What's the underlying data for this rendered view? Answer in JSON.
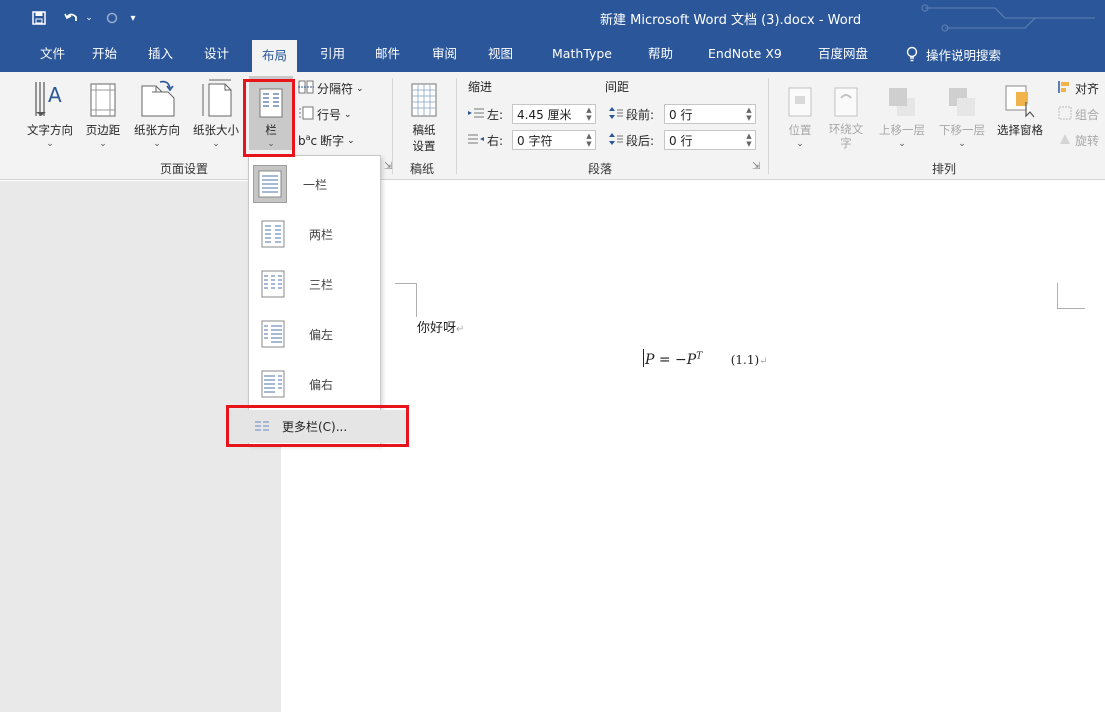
{
  "window": {
    "title": "新建 Microsoft Word 文档 (3).docx - Word"
  },
  "tabs": [
    {
      "label": "文件"
    },
    {
      "label": "开始"
    },
    {
      "label": "插入"
    },
    {
      "label": "设计"
    },
    {
      "label": "布局"
    },
    {
      "label": "引用"
    },
    {
      "label": "邮件"
    },
    {
      "label": "审阅"
    },
    {
      "label": "视图"
    },
    {
      "label": "MathType"
    },
    {
      "label": "帮助"
    },
    {
      "label": "EndNote X9"
    },
    {
      "label": "百度网盘"
    }
  ],
  "active_tab": "布局",
  "tell_me": "操作说明搜索",
  "ribbon": {
    "page_setup": {
      "text_direction": "文字方向",
      "margins": "页边距",
      "orientation": "纸张方向",
      "size": "纸张大小",
      "columns": "栏",
      "breaks": "分隔符",
      "line_numbers": "行号",
      "hyphenation": "断字",
      "group_label": "页面设置"
    },
    "manuscript": {
      "button_line1": "稿纸",
      "button_line2": "设置",
      "group_label": "稿纸"
    },
    "paragraph": {
      "indent_header": "缩进",
      "spacing_header": "间距",
      "left_label": "左:",
      "left_value": "4.45 厘米",
      "right_label": "右:",
      "right_value": "0 字符",
      "before_label": "段前:",
      "before_value": "0 行",
      "after_label": "段后:",
      "after_value": "0 行",
      "group_label": "段落"
    },
    "arrange": {
      "position": "位置",
      "wrap_text_line1": "环绕文",
      "wrap_text_line2": "字",
      "bring_forward": "上移一层",
      "send_backward": "下移一层",
      "selection_pane": "选择窗格",
      "align": "对齐",
      "group": "组合",
      "rotate": "旋转",
      "group_label": "排列"
    }
  },
  "columns_menu": {
    "items": [
      {
        "label": "一栏"
      },
      {
        "label": "两栏"
      },
      {
        "label": "三栏"
      },
      {
        "label": "偏左"
      },
      {
        "label": "偏右"
      }
    ],
    "more": "更多栏(C)..."
  },
  "document": {
    "line1": "你好呀",
    "equation_lhs": "P",
    "equation_mid": " = −",
    "equation_rhs": "P",
    "equation_sup": "T",
    "equation_number": "(1.1)"
  },
  "colors": {
    "title_bar": "#2b579a",
    "ribbon": "#f3f3f3",
    "highlight": "#e8141c"
  }
}
